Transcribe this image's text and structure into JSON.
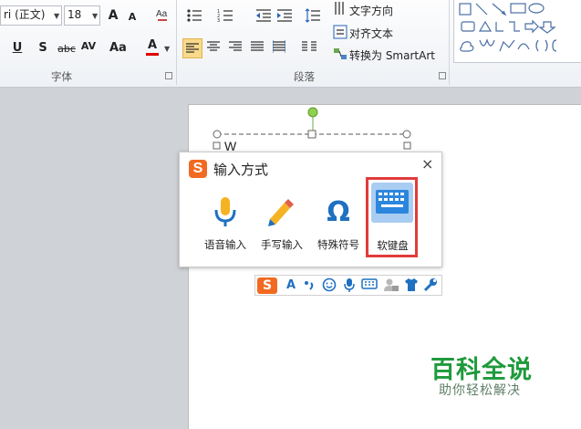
{
  "ribbon": {
    "font": {
      "name_value": "ri (正文)",
      "size_value": "18",
      "group_label": "字体",
      "grow_label": "A",
      "shrink_label": "A",
      "underline_label": "U",
      "shadow_label": "S",
      "strike_label": "abc",
      "spacing_label": "AV",
      "case_label": "Aa",
      "color_label": "A"
    },
    "paragraph": {
      "group_label": "段落",
      "text_direction_label": "文字方向",
      "align_text_label": "对齐文本",
      "smartart_label": "转换为 SmartArt"
    }
  },
  "document": {
    "textbox_text": "W"
  },
  "dialog": {
    "title": "输入方式",
    "close_glyph": "×",
    "options": [
      {
        "label": "语音输入",
        "icon": "microphone-icon"
      },
      {
        "label": "手写输入",
        "icon": "pencil-icon"
      },
      {
        "label": "特殊符号",
        "icon": "omega-icon"
      },
      {
        "label": "软键盘",
        "icon": "keyboard-icon"
      }
    ],
    "highlight_color": "#e23b3b",
    "accent_color": "#1f70c1"
  },
  "ime_toolbar": {
    "items": [
      "sogou-logo-icon",
      "font-icon",
      "punctuation-icon",
      "emoji-icon",
      "microphone-icon",
      "keyboard-icon",
      "user-icon",
      "skin-icon",
      "wrench-icon"
    ],
    "font_glyph": "A"
  },
  "watermark": {
    "title": "百科全说",
    "subtitle": "助你轻松解决"
  }
}
